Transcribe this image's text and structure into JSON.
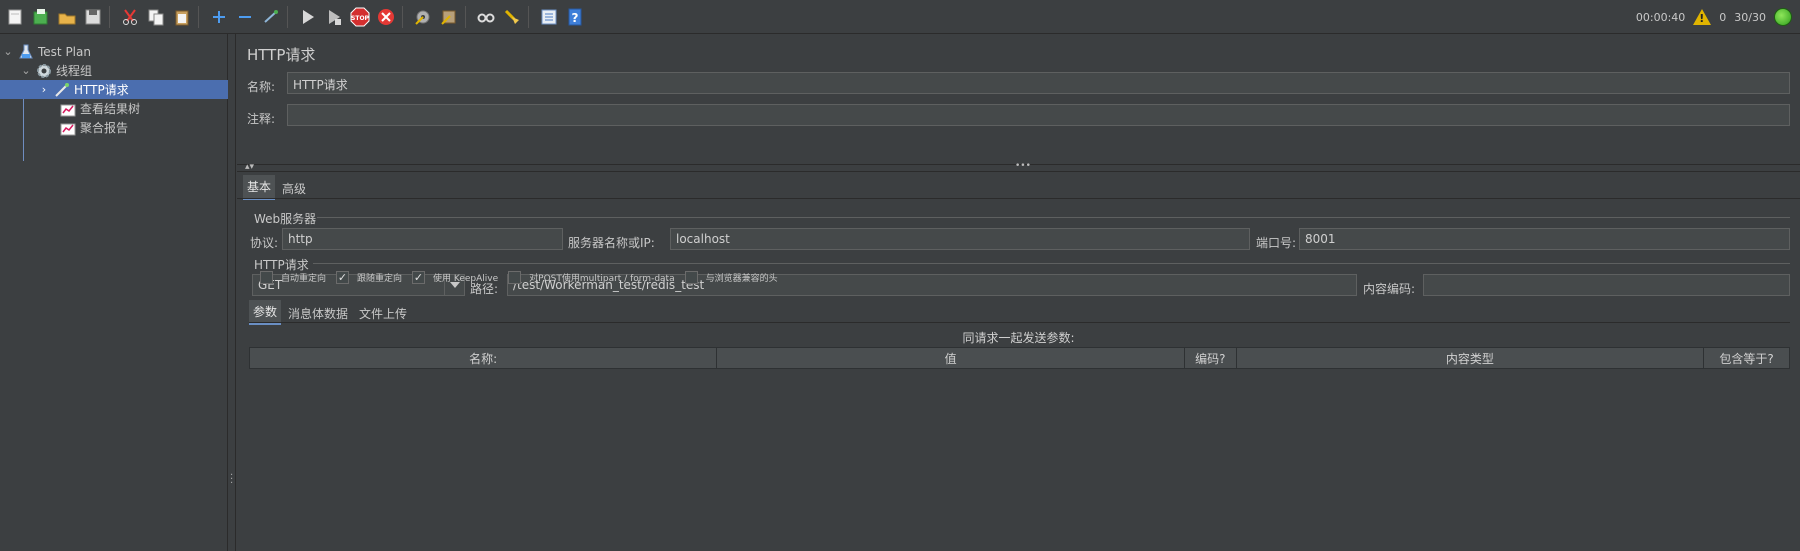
{
  "toolbar": {
    "icons": [
      "new-file-icon",
      "templates-icon",
      "open-icon",
      "save-icon",
      "cut-icon",
      "copy-icon",
      "paste-icon",
      "expand-icon",
      "collapse-icon",
      "toggle-icon",
      "start-icon",
      "start-no-pause-icon",
      "stop-icon",
      "shutdown-icon",
      "clear-icon",
      "clear-all-icon",
      "search-icon",
      "reset-search-icon",
      "function-helper-icon",
      "help-icon"
    ],
    "elapsed_time": "00:00:40",
    "warning_count": "0",
    "threads": "30/30"
  },
  "tree": {
    "test_plan": "Test Plan",
    "thread_group": "线程组",
    "http_request": "HTTP请求",
    "view_results_tree": "查看结果树",
    "aggregate_report": "聚合报告"
  },
  "panel": {
    "title": "HTTP请求",
    "name_label": "名称:",
    "name_value": "HTTP请求",
    "comment_label": "注释:",
    "comment_value": "",
    "tabs": {
      "basic": "基本",
      "advanced": "高级"
    },
    "web_server": {
      "title": "Web服务器",
      "protocol_label": "协议:",
      "protocol_value": "http",
      "server_label": "服务器名称或IP:",
      "server_value": "localhost",
      "port_label": "端口号:",
      "port_value": "8001"
    },
    "http_request": {
      "title": "HTTP请求",
      "method": "GET",
      "path_label": "路径:",
      "path_value": "/test/Workerman_test/redis_test",
      "encoding_label": "内容编码:",
      "encoding_value": ""
    },
    "options": [
      {
        "label": "自动重定向",
        "checked": false
      },
      {
        "label": "跟随重定向",
        "checked": true
      },
      {
        "label": "使用 KeepAlive",
        "checked": true
      },
      {
        "label": "对POST使用multipart / form-data",
        "checked": false
      },
      {
        "label": "与浏览器兼容的头",
        "checked": false
      }
    ],
    "sub_tabs": {
      "params": "参数",
      "body_data": "消息体数据",
      "file_upload": "文件上传"
    },
    "params_caption": "同请求一起发送参数:",
    "table_headers": [
      "名称:",
      "值",
      "编码?",
      "内容类型",
      "包含等于?"
    ]
  },
  "colors": {
    "background": "#3c3f41",
    "selection": "#4b6eaf",
    "field": "#45494a",
    "accent_green": "#2f9e1d",
    "warning": "#e0b400"
  }
}
